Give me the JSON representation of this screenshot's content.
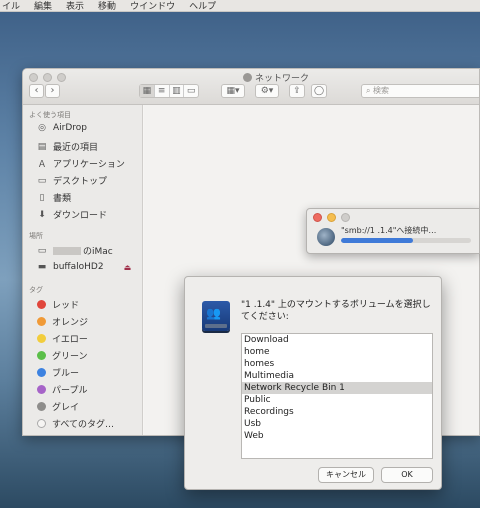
{
  "menubar": {
    "items": [
      "イル",
      "編集",
      "表示",
      "移動",
      "ウインドウ",
      "ヘルプ"
    ]
  },
  "finder": {
    "title": "ネットワーク",
    "back": "‹",
    "forward": "›",
    "search_placeholder": "検索",
    "sidebar": {
      "favorites_header": "よく使う項目",
      "favorites": [
        {
          "label": "AirDrop",
          "icon": "airdrop-icon"
        },
        {
          "label": "最近の項目",
          "icon": "recents-icon"
        },
        {
          "label": "アプリケーション",
          "icon": "applications-icon"
        },
        {
          "label": "デスクトップ",
          "icon": "desktop-icon"
        },
        {
          "label": "書類",
          "icon": "documents-icon"
        },
        {
          "label": "ダウンロード",
          "icon": "downloads-icon"
        }
      ],
      "locations_header": "場所",
      "locations": [
        {
          "label": "のiMac",
          "icon": "imac-icon"
        },
        {
          "label": "buffaloHD2",
          "icon": "external-drive-icon",
          "eject": "⏏"
        }
      ],
      "tags_header": "タグ",
      "tags": [
        {
          "label": "レッド",
          "color": "#e0463c"
        },
        {
          "label": "オレンジ",
          "color": "#f09a37"
        },
        {
          "label": "イエロー",
          "color": "#f2cd3c"
        },
        {
          "label": "グリーン",
          "color": "#5bbf49"
        },
        {
          "label": "ブルー",
          "color": "#3d82e0"
        },
        {
          "label": "パープル",
          "color": "#a664c8"
        },
        {
          "label": "グレイ",
          "color": "#8e8d8b"
        },
        {
          "label": "すべてのタグ…",
          "color": "#f6f5f3"
        }
      ]
    }
  },
  "connecting": {
    "message": "\"smb://1  .1.4\"へ接続中…",
    "progress": 0.55
  },
  "mount_dialog": {
    "message": "\"1  .1.4\" 上のマウントするボリュームを選択してください:",
    "volumes": [
      "Download",
      "home",
      "homes",
      "Multimedia",
      "Network Recycle Bin 1",
      "Public",
      "Recordings",
      "Usb",
      "Web"
    ],
    "selected_index": 4,
    "cancel_label": "キャンセル",
    "ok_label": "OK"
  }
}
